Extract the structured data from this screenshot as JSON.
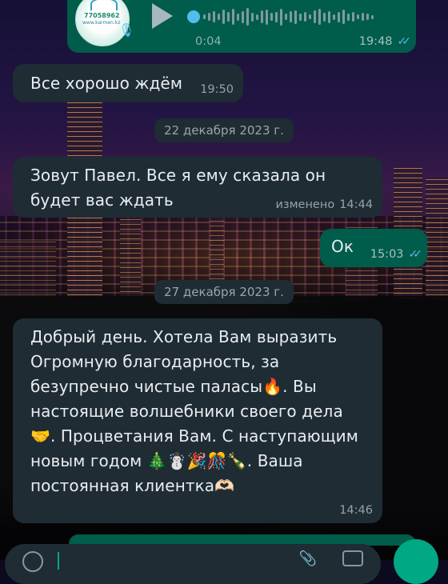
{
  "voice_note": {
    "duration": "0:04",
    "time": "19:48",
    "avatar_text_line1": "77058962",
    "avatar_text_line2": "www.karmen.kz"
  },
  "messages": [
    {
      "dir": "in",
      "text": "Все хорошо ждём",
      "time": "19:50"
    },
    {
      "dir": "in",
      "text": "Зовут Павел. Все я ему сказала он\nбудет вас ждать",
      "edited_label": "изменено",
      "time": "14:44"
    },
    {
      "dir": "out",
      "text": "Ок",
      "time": "15:03"
    },
    {
      "dir": "in",
      "text": "Добрый день. Хотела Вам выразить\nОгромную благодарность, за\nбезупречно чистые паласы🔥. Вы\nнастоящие волшебники своего дела\n🤝. Процветания Вам. С наступающим\nновым годом 🎄☃️🎉🎊🍾. Ваша\nпостоянная клиентка🫶🏻",
      "time": "14:46"
    }
  ],
  "date_separators": [
    "22 декабря 2023 г.",
    "27 декабря 2023 г."
  ],
  "colors": {
    "incoming_bubble": "#1f2c34",
    "outgoing_bubble": "#005c4b",
    "read_ticks": "#53bdeb",
    "accent": "#00a884"
  },
  "icons": [
    "microphone-icon",
    "play-icon",
    "double-check-icon",
    "emoji-icon",
    "attach-icon",
    "camera-icon",
    "mic-send-icon"
  ]
}
